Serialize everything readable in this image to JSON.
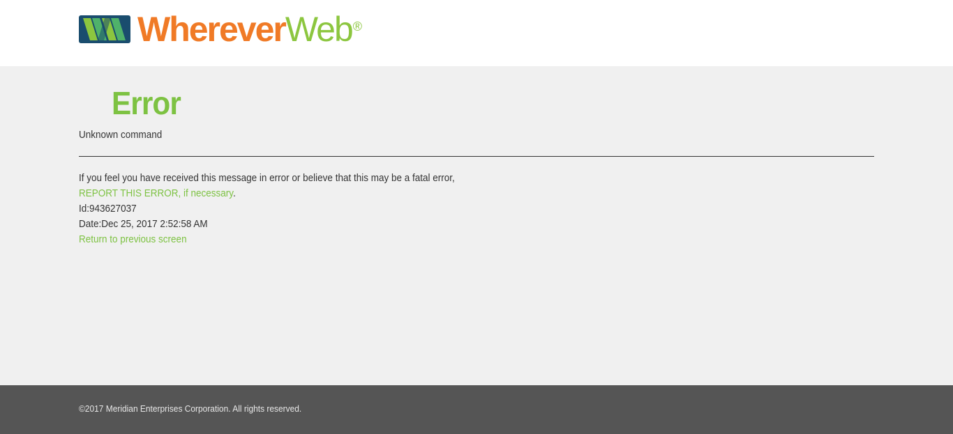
{
  "header": {
    "logo": {
      "word1": "Wherever",
      "word2": "Web",
      "registered": "®",
      "icon": "ww-logo-icon"
    }
  },
  "content": {
    "title": "Error",
    "message": "Unknown command",
    "info_line": "If you feel you have received this message in error or believe that this may be a fatal error,",
    "report_link": "REPORT THIS ERROR, if necessary",
    "report_suffix": ".",
    "id_label": "Id:",
    "id_value": "943627037",
    "date_label": "Date:",
    "date_value": "Dec 25, 2017 2:52:58 AM",
    "return_link": "Return to previous screen"
  },
  "footer": {
    "copyright": "©2017 Meridian Enterprises Corporation. All rights reserved."
  },
  "colors": {
    "orange": "#f07a26",
    "green": "#7dc242",
    "navy": "#1a4d6e",
    "footer_bg": "#555555",
    "page_bg": "#f0f0f0"
  }
}
